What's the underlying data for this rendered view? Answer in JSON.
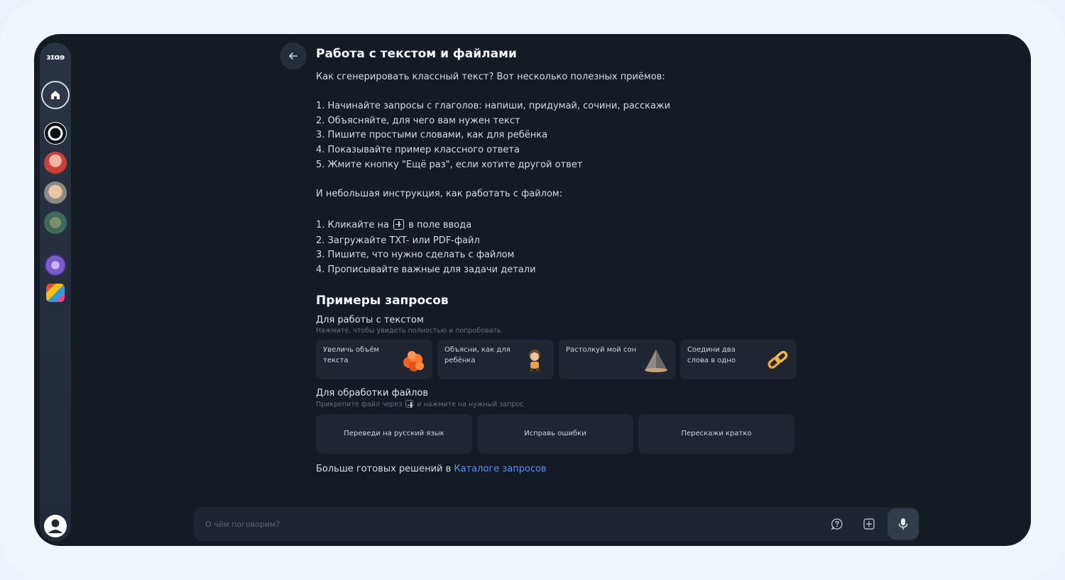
{
  "sidebar": {
    "logo": "ɜɪɑɘ",
    "items": [
      {
        "icon": "home-icon"
      },
      {
        "icon": "gigachat-logo-icon"
      },
      {
        "icon": "avatar-red-hair"
      },
      {
        "icon": "avatar-gray-hair"
      },
      {
        "icon": "avatar-green"
      },
      {
        "icon": "avatar-purple-flower"
      },
      {
        "icon": "avatar-colorful"
      }
    ],
    "profile_icon": "user-profile-icon"
  },
  "page": {
    "back_icon": "arrow-left-icon",
    "title": "Работа с текстом и файлами",
    "intro": "Как сгенерировать классный текст? Вот несколько полезных приёмов:",
    "tips": [
      "1. Начинайте запросы с глаголов: напиши, придумай, сочини, расскажи",
      "2. Объясняйте, для чего вам нужен текст",
      "3. Пишите простыми словами, как для ребёнка",
      "4. Показывайте пример классного ответа",
      "5. Жмите кнопку \"Ещё раз\", если хотите другой ответ"
    ],
    "file_intro": "И небольшая инструкция, как работать с файлом:",
    "file_step1_before": "1. Кликайте на",
    "file_step1_after": "в поле ввода",
    "file_steps": [
      "2. Загружайте TXT- или PDF-файл",
      "3. Пишите, что нужно сделать с файлом",
      "4. Прописывайте важные для задачи детали"
    ],
    "examples_title": "Примеры запросов",
    "text_section": {
      "title": "Для работы с текстом",
      "hint": "Нажмите, чтобы увидеть полностью и попробовать",
      "cards": [
        {
          "label": "Увеличь объём текста",
          "icon": "orange-spheres-icon"
        },
        {
          "label": "Объясни, как для ребёнка",
          "icon": "toy-figure-icon"
        },
        {
          "label": "Растолкуй мой сон",
          "icon": "pyramid-icon"
        },
        {
          "label": "Соедини два слова в одно",
          "icon": "chain-link-icon"
        }
      ]
    },
    "file_section": {
      "title": "Для обработки файлов",
      "hint_before": "Прикрепите файл через",
      "hint_after": "и нажмите на нужный запрос",
      "cards": [
        {
          "label": "Переведи на русский язык"
        },
        {
          "label": "Исправь ошибки"
        },
        {
          "label": "Перескажи кратко"
        }
      ]
    },
    "more_text": "Больше готовых решений в ",
    "more_link": "Каталоге запросов"
  },
  "input": {
    "placeholder": "О чём поговорим?",
    "value": ""
  },
  "colors": {
    "background": "#151b25",
    "accent_link": "#5d8ff2",
    "card": "#1f2631"
  }
}
